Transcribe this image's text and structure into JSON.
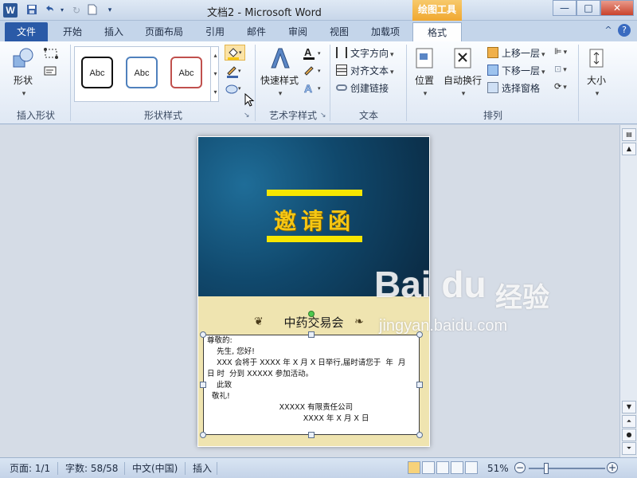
{
  "window": {
    "title": "文档2 - Microsoft Word",
    "tools_tab": "绘图工具",
    "app_icon": "W",
    "qa_icons": [
      "save-icon",
      "undo-icon",
      "redo-icon",
      "new-doc-icon",
      "customize-icon"
    ],
    "controls": {
      "minimize": "—",
      "maximize": "□",
      "close": "✕"
    }
  },
  "tabs": {
    "file": "文件",
    "items": [
      "开始",
      "插入",
      "页面布局",
      "引用",
      "邮件",
      "审阅",
      "视图",
      "加载项",
      "格式"
    ],
    "active": "格式",
    "collapse_icon": "^",
    "help_icon": "?"
  },
  "ribbon": {
    "insert_shapes": {
      "label": "插入形状",
      "shapes_button": "形状"
    },
    "shape_styles": {
      "label": "形状样式",
      "styles": [
        {
          "text": "Abc",
          "border": "#111111"
        },
        {
          "text": "Abc",
          "border": "#4f81bd"
        },
        {
          "text": "Abc",
          "border": "#c0504d"
        }
      ]
    },
    "wordart_styles": {
      "label": "艺术字样式",
      "quick_styles": "快速样式"
    },
    "text": {
      "label": "文本",
      "items": [
        "文字方向",
        "对齐文本",
        "创建链接"
      ]
    },
    "arrange": {
      "label": "排列",
      "position": "位置",
      "wrap": "自动换行",
      "items": [
        "上移一层",
        "下移一层",
        "选择窗格"
      ]
    },
    "size": {
      "label": "大小"
    }
  },
  "document": {
    "cover_title": "邀请函",
    "fair_name": "中药交易会",
    "ornament_left": "❦",
    "ornament_right": "❧",
    "lines": [
      "尊敬的:",
      "    先生, 您好!",
      "    XXX 会将于 XXXX 年 X 月 X 日举行,届时请您于  年  月",
      "日 时  分到 XXXXX 参加活动。",
      "    此致",
      "  敬礼!",
      "                              XXXXX 有限责任公司",
      "                                        XXXX 年 X 月 X 日"
    ]
  },
  "statusbar": {
    "page": "页面: 1/1",
    "words": "字数: 58/58",
    "language": "中文(中国)",
    "mode": "插入",
    "zoom": "51%",
    "zoom_fraction": 0.51,
    "minus": "−",
    "plus": "+"
  },
  "watermark": {
    "logo": "Bai du",
    "cn": "经验",
    "url": "jingyan.baidu.com"
  },
  "colors": {
    "accent": "#2a5aa7",
    "tools_tab": "#f0a830",
    "cover_title": "#f5c613",
    "stripe": "#f7e600",
    "band": "#efe4b0"
  }
}
